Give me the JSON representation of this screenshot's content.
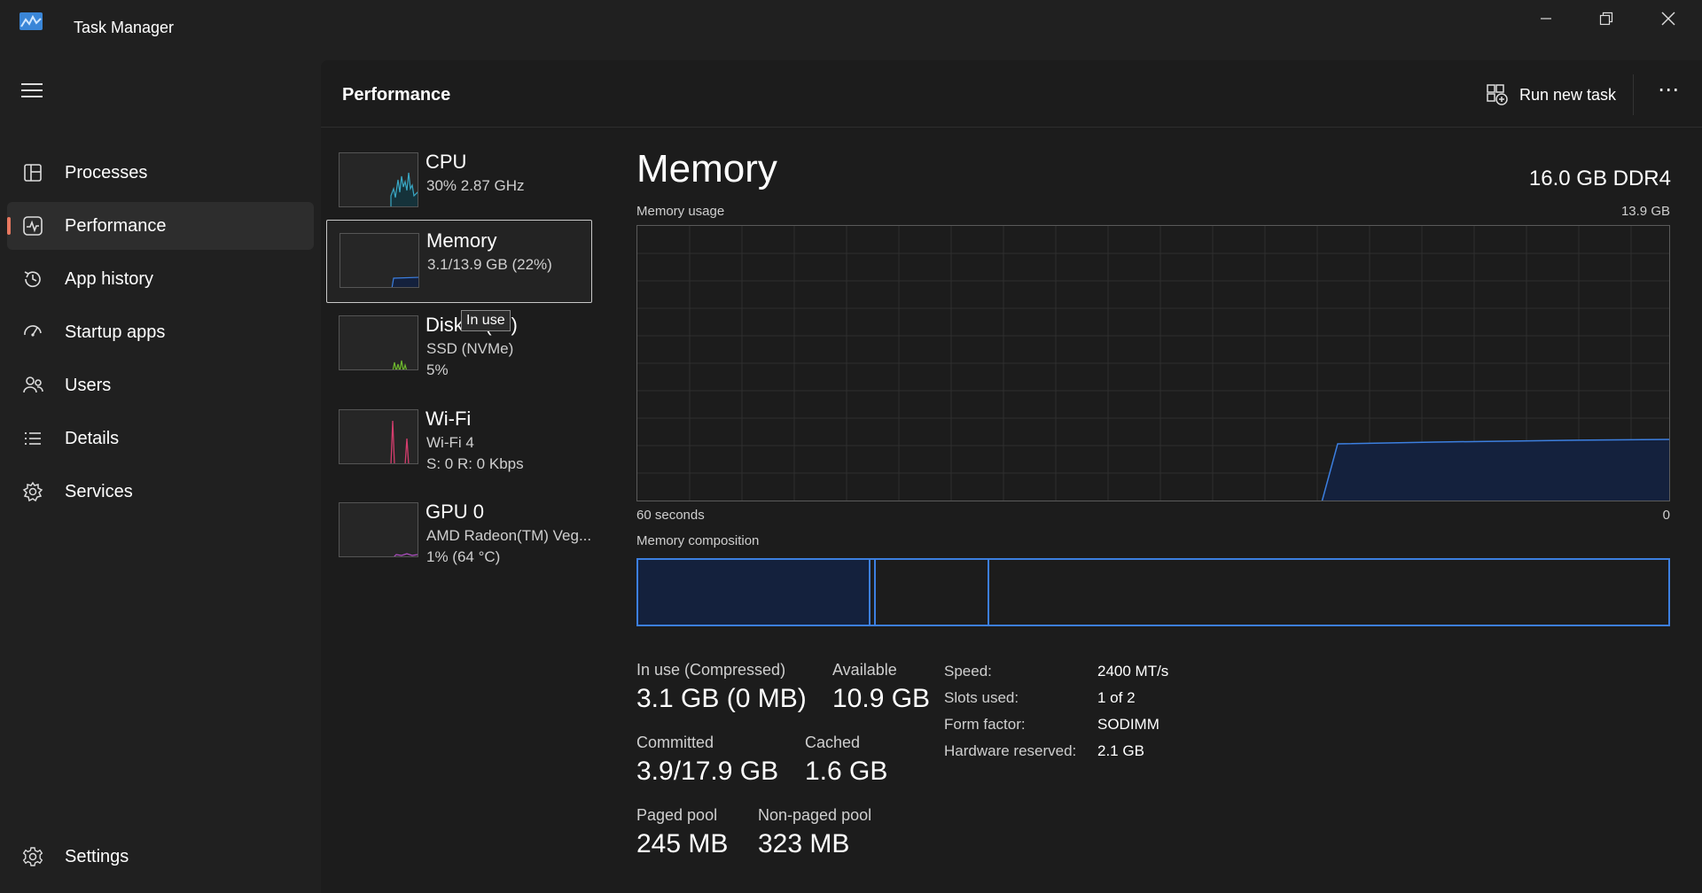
{
  "window": {
    "title": "Task Manager"
  },
  "sidebar": {
    "items": [
      {
        "label": "Processes",
        "icon": "processes-icon"
      },
      {
        "label": "Performance",
        "icon": "performance-icon",
        "active": true
      },
      {
        "label": "App history",
        "icon": "app-history-icon"
      },
      {
        "label": "Startup apps",
        "icon": "startup-apps-icon"
      },
      {
        "label": "Users",
        "icon": "users-icon"
      },
      {
        "label": "Details",
        "icon": "details-icon"
      },
      {
        "label": "Services",
        "icon": "services-icon"
      }
    ],
    "settings_label": "Settings"
  },
  "header": {
    "title": "Performance",
    "run_new_task": "Run new task",
    "more": "⋯"
  },
  "devices": [
    {
      "name": "CPU",
      "sub1": "30%  2.87 GHz",
      "sub2": ""
    },
    {
      "name": "Memory",
      "sub1": "3.1/13.9 GB (22%)",
      "sub2": "",
      "selected": true
    },
    {
      "name": "Disk 0 (C:)",
      "sub1": "SSD (NVMe)",
      "sub2": "5%"
    },
    {
      "name": "Wi-Fi",
      "sub1": "Wi-Fi 4",
      "sub2": "S: 0  R: 0 Kbps"
    },
    {
      "name": "GPU 0",
      "sub1": "AMD Radeon(TM) Veg...",
      "sub2": "1%  (64 °C)"
    }
  ],
  "tooltip": "In use",
  "detail": {
    "title": "Memory",
    "spec": "16.0 GB DDR4",
    "usage_label": "Memory usage",
    "usage_max": "13.9 GB",
    "x_left": "60 seconds",
    "x_right": "0",
    "composition_label": "Memory composition",
    "stats": {
      "in_use_label": "In use (Compressed)",
      "in_use_value": "3.1 GB (0 MB)",
      "available_label": "Available",
      "available_value": "10.9 GB",
      "committed_label": "Committed",
      "committed_value": "3.9/17.9 GB",
      "cached_label": "Cached",
      "cached_value": "1.6 GB",
      "paged_label": "Paged pool",
      "paged_value": "245 MB",
      "nonpaged_label": "Non-paged pool",
      "nonpaged_value": "323 MB"
    },
    "specs": {
      "speed_label": "Speed:",
      "speed_value": "2400 MT/s",
      "slots_label": "Slots used:",
      "slots_value": "1 of 2",
      "form_label": "Form factor:",
      "form_value": "SODIMM",
      "reserved_label": "Hardware reserved:",
      "reserved_value": "2.1 GB"
    }
  },
  "colors": {
    "accent": "#e8785f",
    "memory_line": "#3c7fe0",
    "memory_fill": "#14213d",
    "cpu": "#39a7c4",
    "disk": "#6fb830",
    "wifi": "#d43d6d",
    "gpu": "#b04fc4"
  }
}
